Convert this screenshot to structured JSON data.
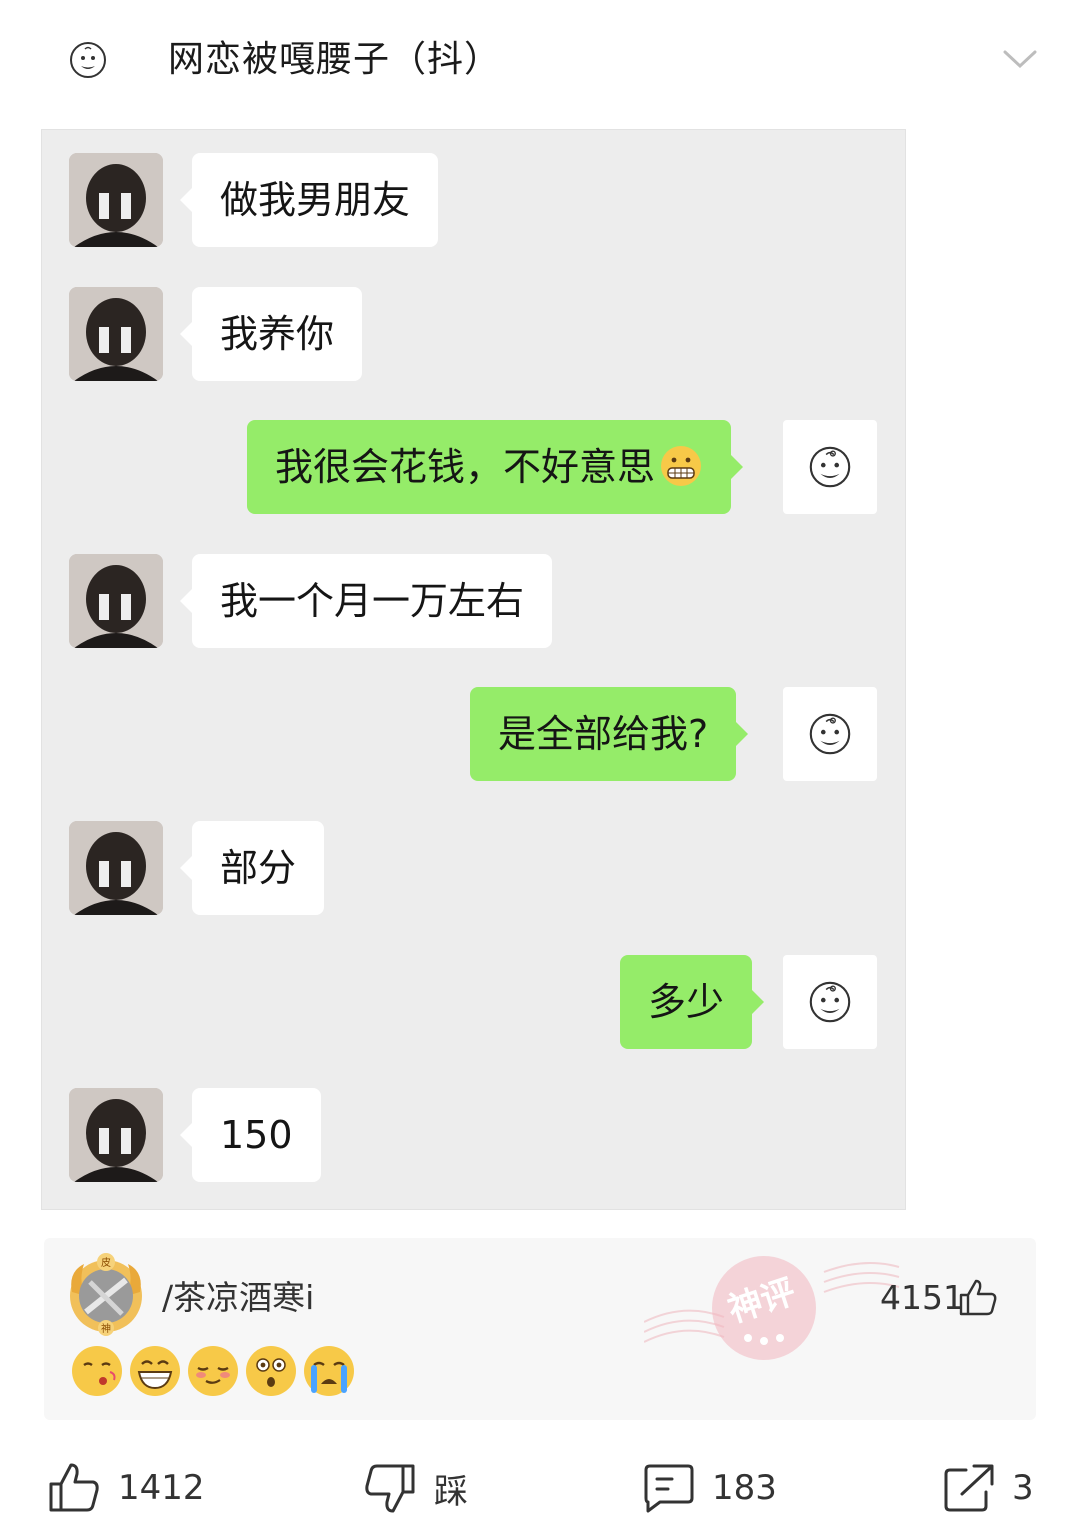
{
  "header": {
    "title": "网恋被嘎腰子（抖）"
  },
  "chat": {
    "messages": [
      {
        "side": "left",
        "text": "做我男朋友"
      },
      {
        "side": "left",
        "text": "我养你"
      },
      {
        "side": "right",
        "text": "我很会花钱，不好意思"
      },
      {
        "side": "left",
        "text": "我一个月一万左右"
      },
      {
        "side": "right",
        "text": "是全部给我?"
      },
      {
        "side": "left",
        "text": "部分"
      },
      {
        "side": "right",
        "text": "多少"
      },
      {
        "side": "left",
        "text": "150"
      }
    ]
  },
  "comment": {
    "username": "/茶凉酒寒i",
    "likes": "4151",
    "stamp_text": "神评",
    "badge_top": "皮",
    "badge_bottom": "神"
  },
  "actions": {
    "like_count": "1412",
    "dislike_label": "踩",
    "comment_count": "183",
    "share_count": "3"
  }
}
